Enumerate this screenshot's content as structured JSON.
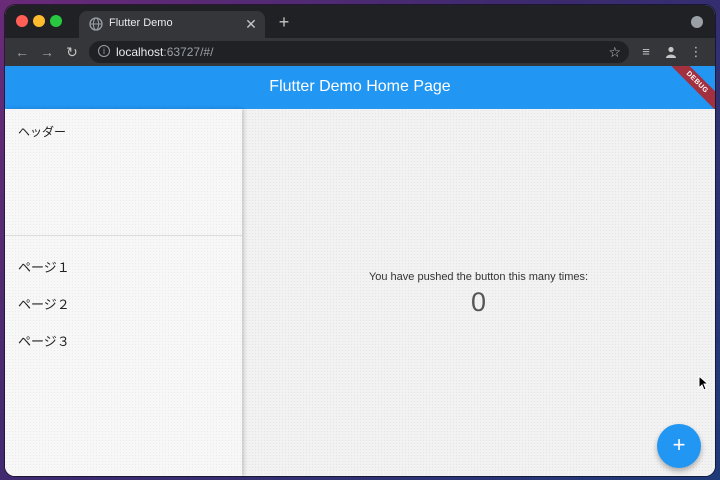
{
  "browser": {
    "tab_title": "Flutter Demo",
    "url_host": "localhost",
    "url_rest": ":63727/#/"
  },
  "app": {
    "title": "Flutter Demo Home Page",
    "debug_banner": "DEBUG",
    "accent_color": "#2196f3"
  },
  "drawer": {
    "header": "ヘッダー",
    "items": [
      {
        "label": "ページ１"
      },
      {
        "label": "ページ２"
      },
      {
        "label": "ページ３"
      }
    ]
  },
  "main": {
    "counter_label": "You have pushed the button this many times:",
    "counter_value": "0"
  },
  "fab": {
    "icon": "add-icon",
    "glyph": "+"
  }
}
